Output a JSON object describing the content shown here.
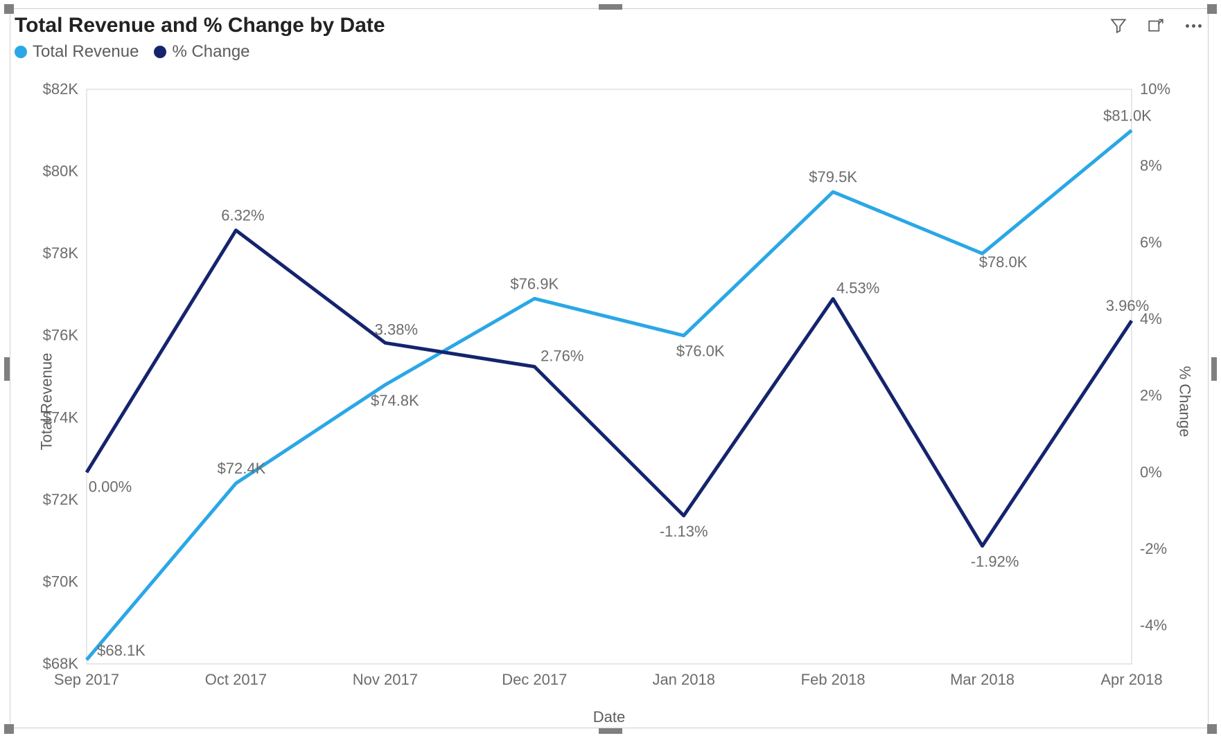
{
  "title": "Total Revenue and % Change by Date",
  "toolbar": {
    "filter_label": "Filters",
    "focus_label": "Focus mode",
    "more_label": "More options"
  },
  "legend": {
    "items": [
      {
        "name": "Total Revenue",
        "color": "#2aa7e6"
      },
      {
        "name": "% Change",
        "color": "#14246e"
      }
    ]
  },
  "axes": {
    "xlabel": "Date",
    "y1label": "Total Revenue",
    "y2label": "% Change"
  },
  "chart_data": {
    "type": "line",
    "categories": [
      "Sep 2017",
      "Oct 2017",
      "Nov 2017",
      "Dec 2017",
      "Jan 2018",
      "Feb 2018",
      "Mar 2018",
      "Apr 2018"
    ],
    "xlabel": "Date",
    "series": [
      {
        "name": "Total Revenue",
        "axis": "y1",
        "color": "#2aa7e6",
        "values": [
          68100,
          72400,
          74800,
          76900,
          76000,
          79500,
          78000,
          81000
        ],
        "labels": [
          "$68.1K",
          "$72.4K",
          "$74.8K",
          "$76.9K",
          "$76.0K",
          "$79.5K",
          "$78.0K",
          "$81.0K"
        ]
      },
      {
        "name": "% Change",
        "axis": "y2",
        "color": "#14246e",
        "values": [
          0.0,
          6.32,
          3.38,
          2.76,
          -1.13,
          4.53,
          -1.92,
          3.96
        ],
        "labels": [
          "0.00%",
          "6.32%",
          "3.38%",
          "2.76%",
          "-1.13%",
          "4.53%",
          "-1.92%",
          "3.96%"
        ]
      }
    ],
    "y1": {
      "label": "Total Revenue",
      "min": 68000,
      "max": 82000,
      "ticks": [
        68000,
        70000,
        72000,
        74000,
        76000,
        78000,
        80000,
        82000
      ],
      "tick_labels": [
        "$68K",
        "$70K",
        "$72K",
        "$74K",
        "$76K",
        "$78K",
        "$80K",
        "$82K"
      ]
    },
    "y2": {
      "label": "% Change",
      "min": -5,
      "max": 10,
      "ticks": [
        -4,
        -2,
        0,
        2,
        4,
        6,
        8,
        10
      ],
      "tick_labels": [
        "-4%",
        "-2%",
        "0%",
        "2%",
        "4%",
        "6%",
        "8%",
        "10%"
      ]
    }
  }
}
